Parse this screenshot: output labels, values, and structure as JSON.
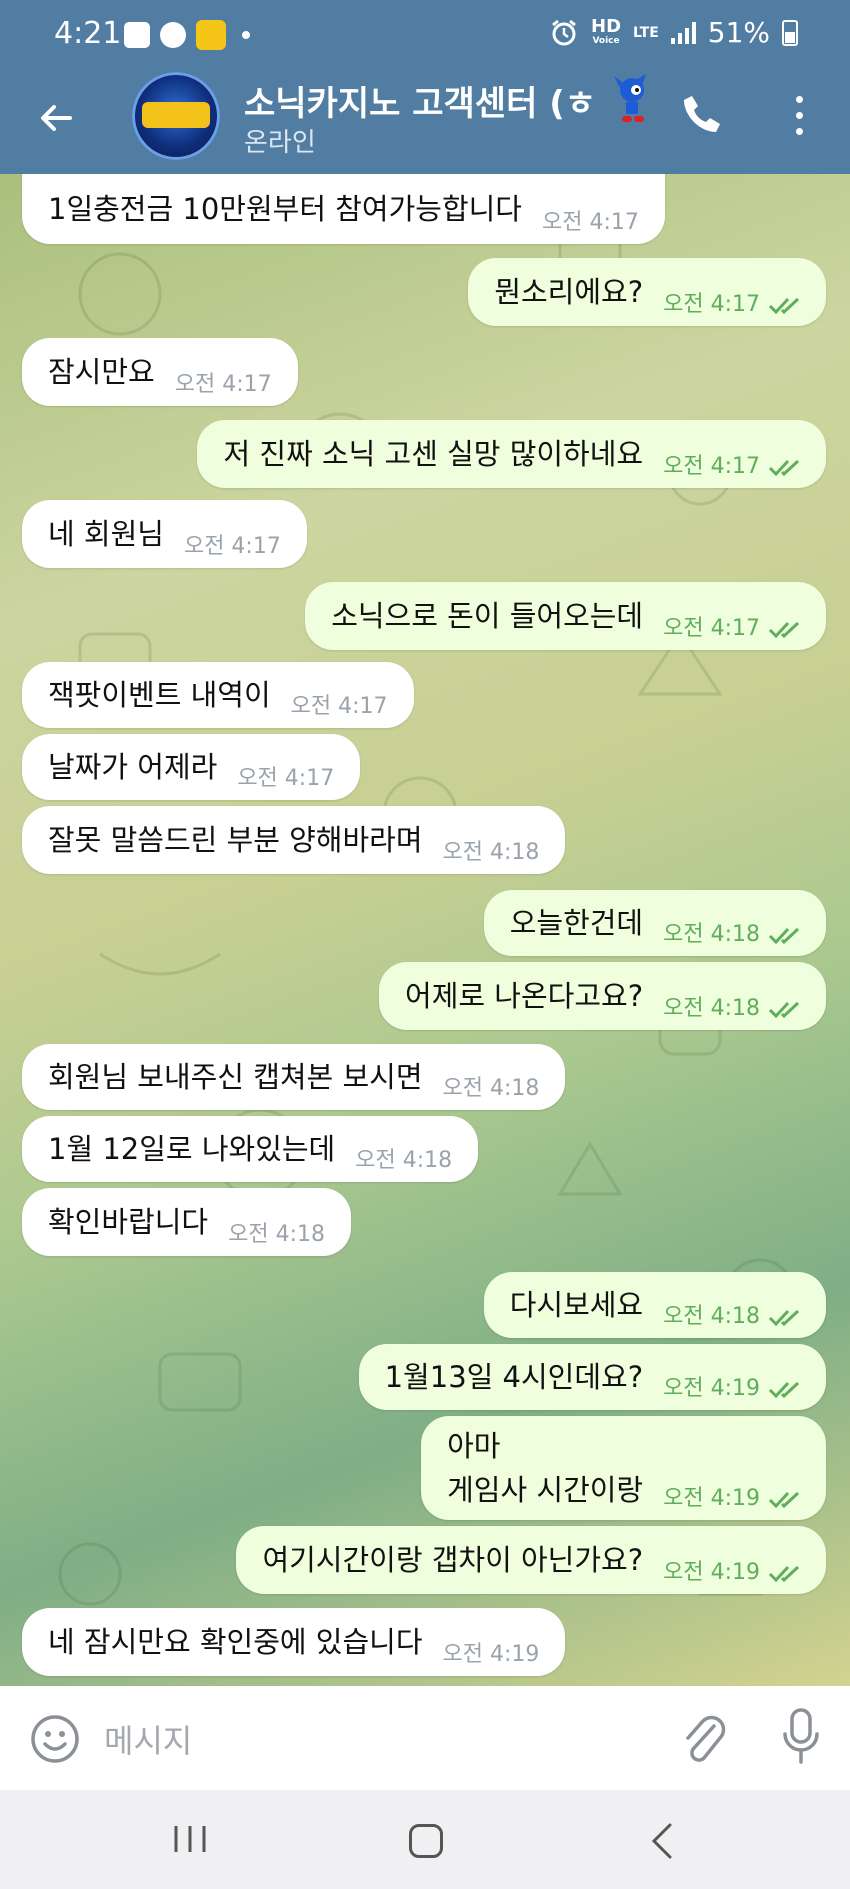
{
  "status_bar": {
    "time": "4:21",
    "battery": "51%",
    "network": "LTE",
    "hd_label": "HD",
    "voice_label": "Voice"
  },
  "header": {
    "title": "소닉카지노 고객센터 (ㅎ",
    "subtitle": "온라인",
    "avatar_name": "소닉카지노 고객센터 logo"
  },
  "messages": [
    {
      "dir": "in",
      "text": "1일충전금 10만원부터 참여가능합니다",
      "time": "오전 4:17"
    },
    {
      "dir": "out",
      "text": "뭔소리에요?",
      "time": "오전 4:17"
    },
    {
      "dir": "in",
      "text": "잠시만요",
      "time": "오전 4:17"
    },
    {
      "dir": "out",
      "text": "저 진짜 소닉 고센 실망 많이하네요",
      "time": "오전 4:17"
    },
    {
      "dir": "in",
      "text": "네 회원님",
      "time": "오전 4:17"
    },
    {
      "dir": "out",
      "text": "소닉으로 돈이 들어오는데",
      "time": "오전 4:17"
    },
    {
      "dir": "in",
      "text": "잭팟이벤트 내역이",
      "time": "오전 4:17"
    },
    {
      "dir": "in",
      "text": "날짜가 어제라",
      "time": "오전 4:17"
    },
    {
      "dir": "in",
      "text": "잘못 말씀드린 부분 양해바라며",
      "time": "오전 4:18"
    },
    {
      "dir": "out",
      "text": "오늘한건데",
      "time": "오전 4:18"
    },
    {
      "dir": "out",
      "text": "어제로 나온다고요?",
      "time": "오전 4:18"
    },
    {
      "dir": "in",
      "text": "회원님 보내주신 캡쳐본 보시면",
      "time": "오전 4:18"
    },
    {
      "dir": "in",
      "text": "1월 12일로 나와있는데",
      "time": "오전 4:18"
    },
    {
      "dir": "in",
      "text": "확인바랍니다",
      "time": "오전 4:18"
    },
    {
      "dir": "out",
      "text": "다시보세요",
      "time": "오전 4:18"
    },
    {
      "dir": "out",
      "text": "1월13일 4시인데요?",
      "time": "오전 4:19"
    },
    {
      "dir": "out",
      "text": "아마\n게임사 시간이랑",
      "time": "오전 4:19"
    },
    {
      "dir": "out",
      "text": "여기시간이랑 갭차이 아닌가요?",
      "time": "오전 4:19"
    },
    {
      "dir": "in",
      "text": "네 잠시만요 확인중에 있습니다",
      "time": "오전 4:19"
    }
  ],
  "input": {
    "placeholder": "메시지"
  },
  "colors": {
    "header_bg": "#517da2",
    "incoming_bubble": "#ffffff",
    "outgoing_bubble": "#effedd",
    "outgoing_time": "#5fae5b",
    "incoming_time": "#9aa3ab"
  },
  "icons": [
    "back-arrow-icon",
    "phone-icon",
    "more-vert-icon",
    "emoji-icon",
    "attach-icon",
    "mic-icon",
    "double-check-icon"
  ]
}
